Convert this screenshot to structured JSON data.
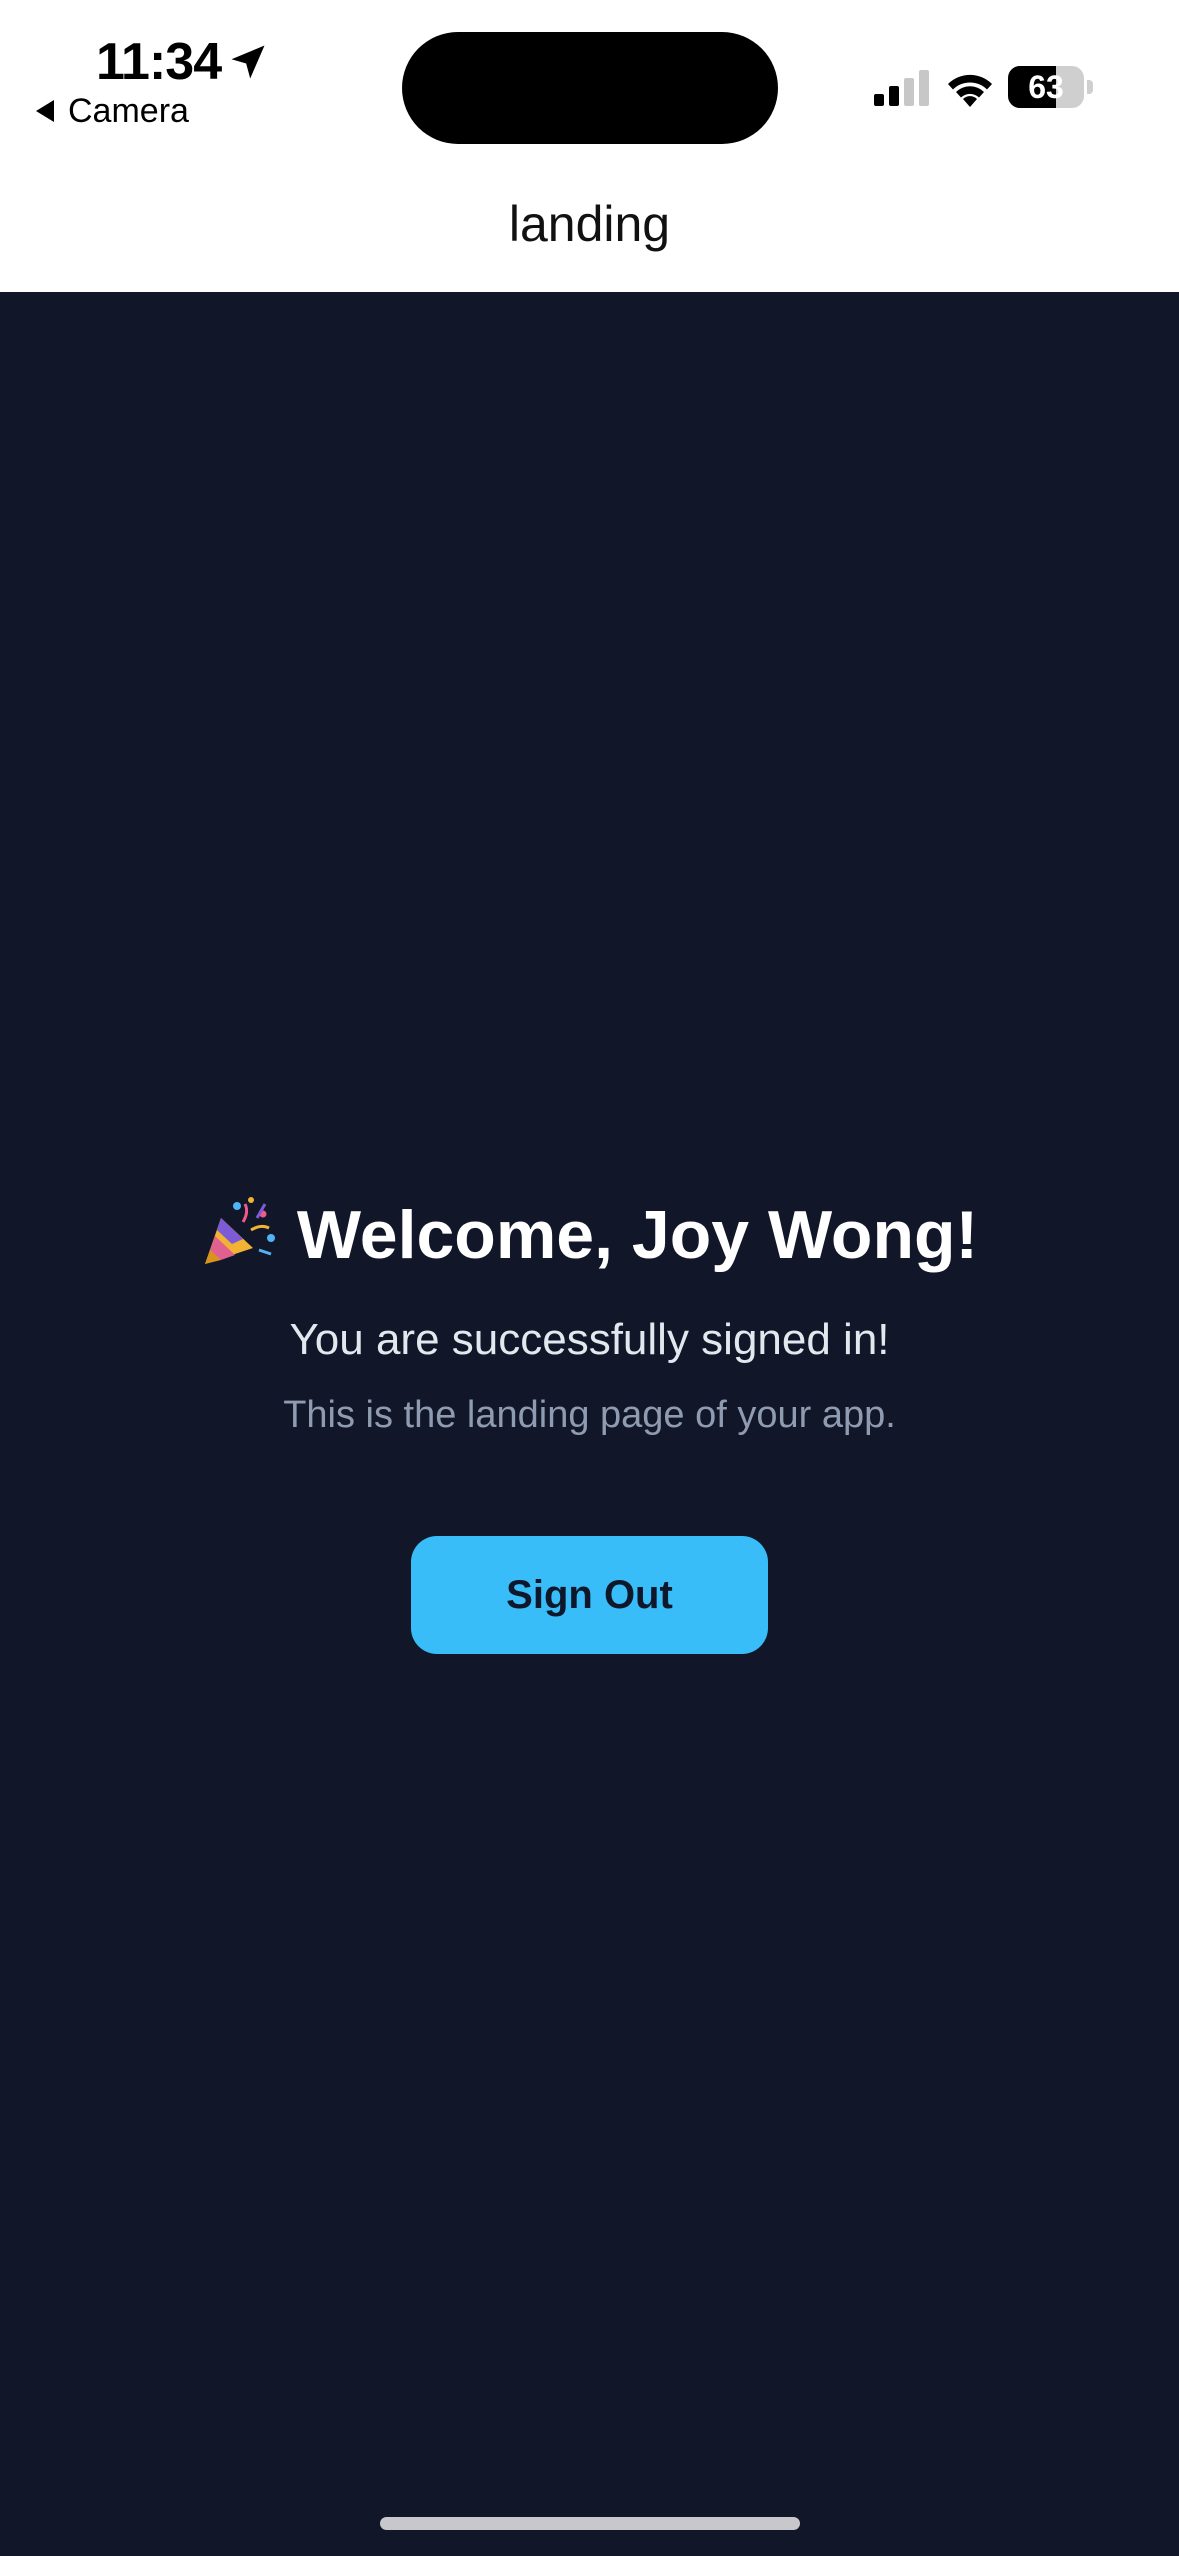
{
  "status_bar": {
    "time": "11:34",
    "back_app_label": "Camera",
    "battery_level": "63",
    "battery_fraction": 0.63,
    "icons": [
      "location-arrow-icon",
      "cellular-signal-icon",
      "wifi-icon",
      "battery-icon"
    ]
  },
  "nav": {
    "title": "landing"
  },
  "main": {
    "welcome_emoji": "party-popper-icon",
    "welcome_text": "Welcome, Joy Wong!",
    "signed_in_text": "You are successfully signed in!",
    "landing_text": "This is the landing page of your app.",
    "sign_out_label": "Sign Out"
  },
  "colors": {
    "background": "#111729",
    "header_background": "#ffffff",
    "button_background": "#38bdf8",
    "button_text": "#0f172a",
    "primary_text": "#ffffff",
    "secondary_text": "#e3e7ee",
    "muted_text": "#8f9bb1"
  }
}
